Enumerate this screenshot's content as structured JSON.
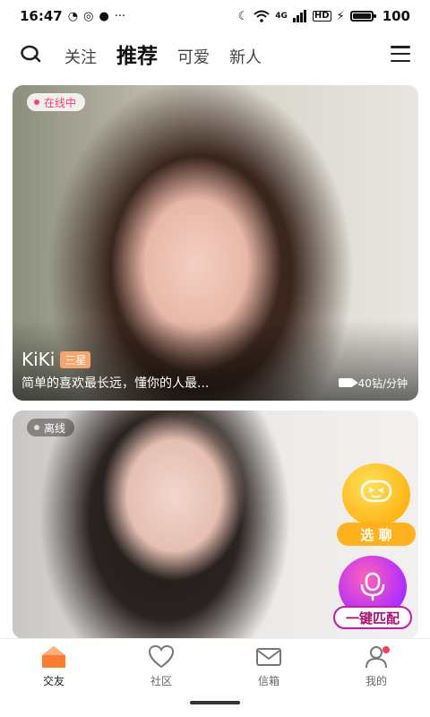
{
  "status_bar": {
    "time": "16:47",
    "network": "4G",
    "hd": "HD",
    "battery": "100"
  },
  "topnav": {
    "tabs": [
      "关注",
      "推荐",
      "可爱",
      "新人"
    ],
    "active_tab": "推荐"
  },
  "cards": [
    {
      "status": "在线中",
      "name": "KiKi",
      "level": "三星",
      "bio": "简单的喜欢最长远，懂你的人最...",
      "price": "40钻/分钟"
    },
    {
      "status": "离线"
    }
  ],
  "floating": {
    "chat_label": "选 聊",
    "match_label": "一键匹配"
  },
  "bottomnav": {
    "items": [
      {
        "label": "交友",
        "icon": "home-icon"
      },
      {
        "label": "社区",
        "icon": "heart-icon"
      },
      {
        "label": "信箱",
        "icon": "mail-icon"
      },
      {
        "label": "我的",
        "icon": "profile-icon"
      }
    ],
    "active": "交友"
  },
  "colors": {
    "accent": "#ff7b2e",
    "badge": "#f6a56d",
    "chat": "#ffb616",
    "match": "#b02cff"
  }
}
